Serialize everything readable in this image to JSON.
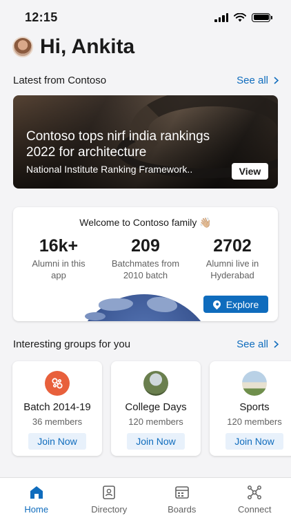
{
  "status": {
    "time": "12:15"
  },
  "greeting": {
    "text": "Hi, Ankita"
  },
  "latest": {
    "title": "Latest from Contoso",
    "see_all": "See all",
    "card": {
      "headline": "Contoso tops nirf india rankings 2022 for architecture",
      "source": "National Institute Ranking Framework..",
      "button": "View"
    }
  },
  "welcome": {
    "title": "Welcome to Contoso family 👋🏼",
    "stats": [
      {
        "value": "16k+",
        "label": "Alumni in this app"
      },
      {
        "value": "209",
        "label": "Batchmates from 2010 batch"
      },
      {
        "value": "2702",
        "label": "Alumni live in Hyderabad"
      }
    ],
    "explore": "Explore"
  },
  "groups": {
    "title": "Interesting groups for you",
    "see_all": "See all",
    "items": [
      {
        "name": "Batch 2014-19",
        "members": "36 members",
        "join": "Join Now",
        "icon": "batch-icon",
        "color": "#e8603c"
      },
      {
        "name": "College Days",
        "members": "120 members",
        "join": "Join Now",
        "icon": "college-photo-icon",
        "color": "#6a7f4e"
      },
      {
        "name": "Sports",
        "members": "120 members",
        "join": "Join Now",
        "icon": "sports-photo-icon",
        "color": "#7e9ab0"
      }
    ]
  },
  "tabs": [
    {
      "label": "Home",
      "icon": "home-icon",
      "active": true
    },
    {
      "label": "Directory",
      "icon": "directory-icon",
      "active": false
    },
    {
      "label": "Boards",
      "icon": "boards-icon",
      "active": false
    },
    {
      "label": "Connect",
      "icon": "connect-icon",
      "active": false
    }
  ],
  "colors": {
    "accent": "#0f6cbd",
    "background": "#f4f4f6"
  }
}
